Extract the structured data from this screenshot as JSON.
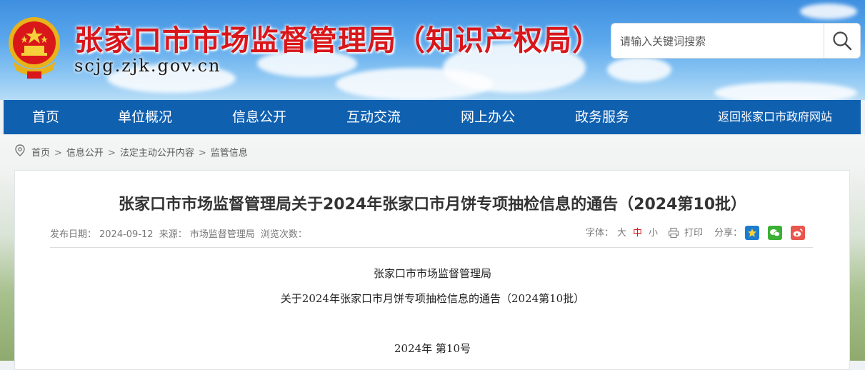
{
  "header": {
    "site_title": "张家口市市场监督管理局（知识产权局）",
    "site_domain": "scjg.zjk.gov.cn"
  },
  "search": {
    "placeholder": "请输入关键词搜索",
    "value": ""
  },
  "nav": {
    "items": [
      {
        "label": "首页"
      },
      {
        "label": "单位概况"
      },
      {
        "label": "信息公开"
      },
      {
        "label": "互动交流"
      },
      {
        "label": "网上办公"
      },
      {
        "label": "政务服务"
      }
    ],
    "return_link": "返回张家口市政府网站"
  },
  "breadcrumb": {
    "items": [
      "首页",
      "信息公开",
      "法定主动公开内容",
      "监管信息"
    ],
    "separator": ">"
  },
  "article": {
    "title": "张家口市市场监督管理局关于2024年张家口市月饼专项抽检信息的通告（2024第10批）",
    "meta": {
      "date_label": "发布日期：",
      "date": "2024-09-12",
      "source_label": "来源：",
      "source": "市场监督管理局",
      "views_label": "浏览次数："
    },
    "tools": {
      "font_label": "字体：",
      "size_large": "大",
      "size_medium": "中",
      "size_small": "小",
      "print": "打印",
      "share_label": "分享："
    },
    "body": {
      "line1": "张家口市市场监督管理局",
      "line2": "关于2024年张家口市月饼专项抽检信息的通告（2024第10批）",
      "line3": "2024年 第10号"
    }
  },
  "colors": {
    "title_red": "#d9161a",
    "nav_blue": "#1060b0",
    "share_star": "#1e7ccf",
    "share_wechat": "#3cb034",
    "share_weibo": "#e8564d"
  }
}
